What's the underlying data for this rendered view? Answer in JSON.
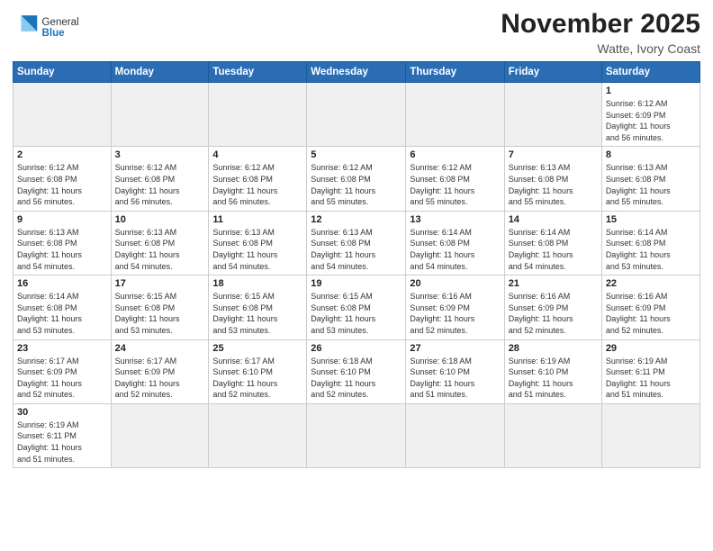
{
  "header": {
    "logo_general": "General",
    "logo_blue": "Blue",
    "month_title": "November 2025",
    "subtitle": "Watte, Ivory Coast"
  },
  "weekdays": [
    "Sunday",
    "Monday",
    "Tuesday",
    "Wednesday",
    "Thursday",
    "Friday",
    "Saturday"
  ],
  "weeks": [
    [
      {
        "day": "",
        "empty": true
      },
      {
        "day": "",
        "empty": true
      },
      {
        "day": "",
        "empty": true
      },
      {
        "day": "",
        "empty": true
      },
      {
        "day": "",
        "empty": true
      },
      {
        "day": "",
        "empty": true
      },
      {
        "day": "1",
        "sunrise": "Sunrise: 6:12 AM",
        "sunset": "Sunset: 6:09 PM",
        "daylight": "Daylight: 11 hours and 56 minutes."
      }
    ],
    [
      {
        "day": "2",
        "sunrise": "Sunrise: 6:12 AM",
        "sunset": "Sunset: 6:08 PM",
        "daylight": "Daylight: 11 hours and 56 minutes."
      },
      {
        "day": "3",
        "sunrise": "Sunrise: 6:12 AM",
        "sunset": "Sunset: 6:08 PM",
        "daylight": "Daylight: 11 hours and 56 minutes."
      },
      {
        "day": "4",
        "sunrise": "Sunrise: 6:12 AM",
        "sunset": "Sunset: 6:08 PM",
        "daylight": "Daylight: 11 hours and 56 minutes."
      },
      {
        "day": "5",
        "sunrise": "Sunrise: 6:12 AM",
        "sunset": "Sunset: 6:08 PM",
        "daylight": "Daylight: 11 hours and 55 minutes."
      },
      {
        "day": "6",
        "sunrise": "Sunrise: 6:12 AM",
        "sunset": "Sunset: 6:08 PM",
        "daylight": "Daylight: 11 hours and 55 minutes."
      },
      {
        "day": "7",
        "sunrise": "Sunrise: 6:13 AM",
        "sunset": "Sunset: 6:08 PM",
        "daylight": "Daylight: 11 hours and 55 minutes."
      },
      {
        "day": "8",
        "sunrise": "Sunrise: 6:13 AM",
        "sunset": "Sunset: 6:08 PM",
        "daylight": "Daylight: 11 hours and 55 minutes."
      }
    ],
    [
      {
        "day": "9",
        "sunrise": "Sunrise: 6:13 AM",
        "sunset": "Sunset: 6:08 PM",
        "daylight": "Daylight: 11 hours and 54 minutes."
      },
      {
        "day": "10",
        "sunrise": "Sunrise: 6:13 AM",
        "sunset": "Sunset: 6:08 PM",
        "daylight": "Daylight: 11 hours and 54 minutes."
      },
      {
        "day": "11",
        "sunrise": "Sunrise: 6:13 AM",
        "sunset": "Sunset: 6:08 PM",
        "daylight": "Daylight: 11 hours and 54 minutes."
      },
      {
        "day": "12",
        "sunrise": "Sunrise: 6:13 AM",
        "sunset": "Sunset: 6:08 PM",
        "daylight": "Daylight: 11 hours and 54 minutes."
      },
      {
        "day": "13",
        "sunrise": "Sunrise: 6:14 AM",
        "sunset": "Sunset: 6:08 PM",
        "daylight": "Daylight: 11 hours and 54 minutes."
      },
      {
        "day": "14",
        "sunrise": "Sunrise: 6:14 AM",
        "sunset": "Sunset: 6:08 PM",
        "daylight": "Daylight: 11 hours and 54 minutes."
      },
      {
        "day": "15",
        "sunrise": "Sunrise: 6:14 AM",
        "sunset": "Sunset: 6:08 PM",
        "daylight": "Daylight: 11 hours and 53 minutes."
      }
    ],
    [
      {
        "day": "16",
        "sunrise": "Sunrise: 6:14 AM",
        "sunset": "Sunset: 6:08 PM",
        "daylight": "Daylight: 11 hours and 53 minutes."
      },
      {
        "day": "17",
        "sunrise": "Sunrise: 6:15 AM",
        "sunset": "Sunset: 6:08 PM",
        "daylight": "Daylight: 11 hours and 53 minutes."
      },
      {
        "day": "18",
        "sunrise": "Sunrise: 6:15 AM",
        "sunset": "Sunset: 6:08 PM",
        "daylight": "Daylight: 11 hours and 53 minutes."
      },
      {
        "day": "19",
        "sunrise": "Sunrise: 6:15 AM",
        "sunset": "Sunset: 6:08 PM",
        "daylight": "Daylight: 11 hours and 53 minutes."
      },
      {
        "day": "20",
        "sunrise": "Sunrise: 6:16 AM",
        "sunset": "Sunset: 6:09 PM",
        "daylight": "Daylight: 11 hours and 52 minutes."
      },
      {
        "day": "21",
        "sunrise": "Sunrise: 6:16 AM",
        "sunset": "Sunset: 6:09 PM",
        "daylight": "Daylight: 11 hours and 52 minutes."
      },
      {
        "day": "22",
        "sunrise": "Sunrise: 6:16 AM",
        "sunset": "Sunset: 6:09 PM",
        "daylight": "Daylight: 11 hours and 52 minutes."
      }
    ],
    [
      {
        "day": "23",
        "sunrise": "Sunrise: 6:17 AM",
        "sunset": "Sunset: 6:09 PM",
        "daylight": "Daylight: 11 hours and 52 minutes."
      },
      {
        "day": "24",
        "sunrise": "Sunrise: 6:17 AM",
        "sunset": "Sunset: 6:09 PM",
        "daylight": "Daylight: 11 hours and 52 minutes."
      },
      {
        "day": "25",
        "sunrise": "Sunrise: 6:17 AM",
        "sunset": "Sunset: 6:10 PM",
        "daylight": "Daylight: 11 hours and 52 minutes."
      },
      {
        "day": "26",
        "sunrise": "Sunrise: 6:18 AM",
        "sunset": "Sunset: 6:10 PM",
        "daylight": "Daylight: 11 hours and 52 minutes."
      },
      {
        "day": "27",
        "sunrise": "Sunrise: 6:18 AM",
        "sunset": "Sunset: 6:10 PM",
        "daylight": "Daylight: 11 hours and 51 minutes."
      },
      {
        "day": "28",
        "sunrise": "Sunrise: 6:19 AM",
        "sunset": "Sunset: 6:10 PM",
        "daylight": "Daylight: 11 hours and 51 minutes."
      },
      {
        "day": "29",
        "sunrise": "Sunrise: 6:19 AM",
        "sunset": "Sunset: 6:11 PM",
        "daylight": "Daylight: 11 hours and 51 minutes."
      }
    ],
    [
      {
        "day": "30",
        "sunrise": "Sunrise: 6:19 AM",
        "sunset": "Sunset: 6:11 PM",
        "daylight": "Daylight: 11 hours and 51 minutes."
      },
      {
        "day": "",
        "empty": true
      },
      {
        "day": "",
        "empty": true
      },
      {
        "day": "",
        "empty": true
      },
      {
        "day": "",
        "empty": true
      },
      {
        "day": "",
        "empty": true
      },
      {
        "day": "",
        "empty": true
      }
    ]
  ]
}
